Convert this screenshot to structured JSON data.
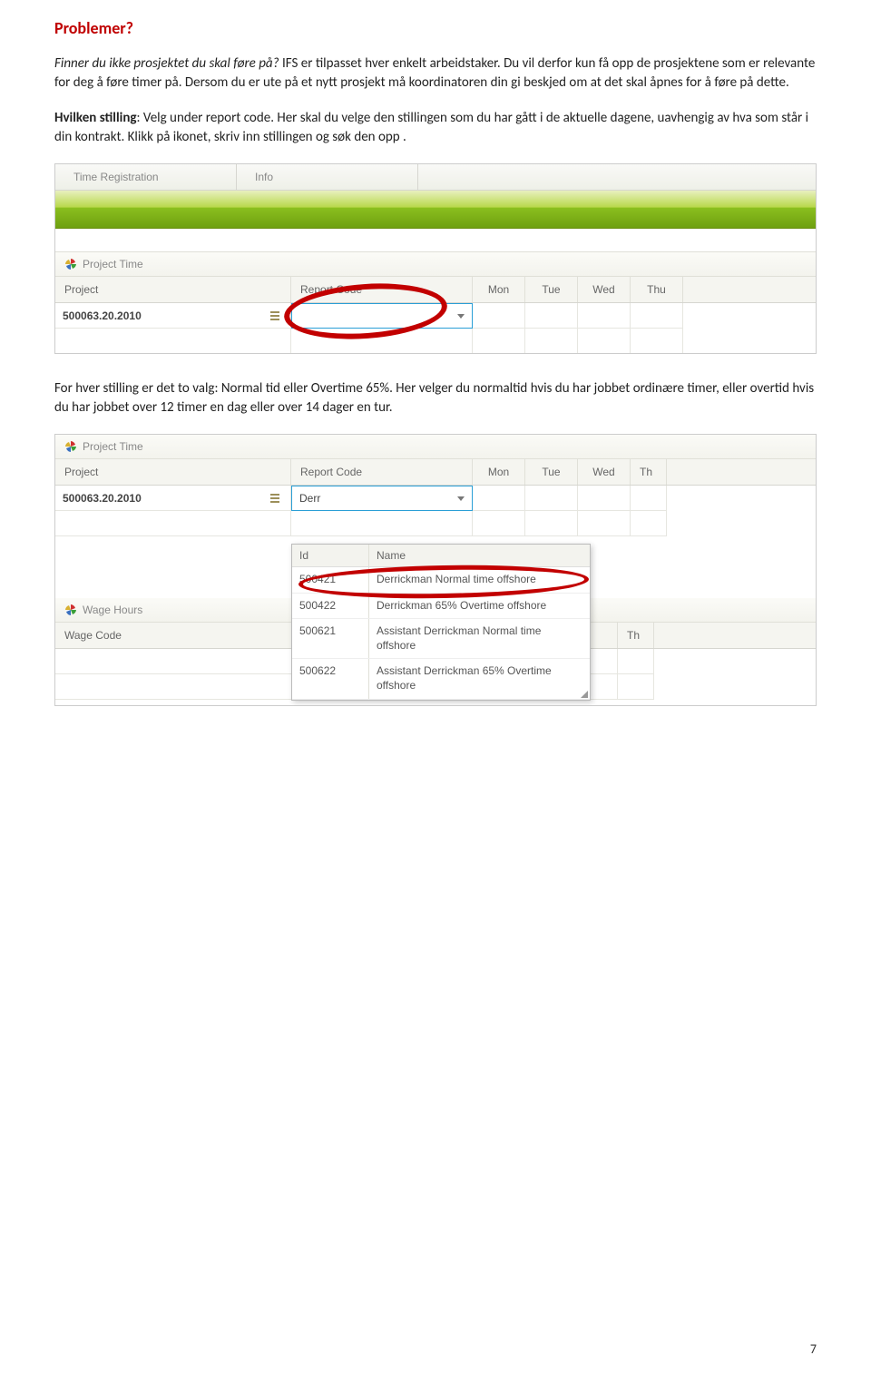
{
  "heading": "Problemer?",
  "para1_italic": "Finner du ikke prosjektet du skal føre på?",
  "para1_rest": " IFS er tilpasset hver enkelt arbeidstaker. Du vil derfor kun få opp de prosjektene som er relevante for deg å føre timer på. Dersom du er ute på et nytt prosjekt må koordinatoren din gi beskjed om at det skal åpnes for å føre på dette.",
  "para2_bold": "Hvilken stilling",
  "para2_rest": ": Velg under report code. Her skal du velge den stillingen som du har gått i de aktuelle dagene, uavhengig av hva som står i din kontrakt. Klikk på ikonet, skriv inn stillingen og søk den opp .",
  "screenshot1": {
    "tabs": [
      "Time Registration",
      "Info"
    ],
    "section": "Project Time",
    "cols": {
      "project": "Project",
      "report": "Report Code",
      "days": [
        "Mon",
        "Tue",
        "Wed",
        "Thu"
      ]
    },
    "project_value": "500063.20.2010"
  },
  "para3": "For hver stilling er det to valg: Normal tid eller Overtime 65%. Her velger du normaltid hvis du har jobbet ordinære timer, eller overtid hvis du har jobbet over 12 timer en dag eller over 14 dager en tur.",
  "screenshot2": {
    "section1": "Project Time",
    "cols": {
      "project": "Project",
      "report": "Report Code",
      "days": [
        "Mon",
        "Tue",
        "Wed",
        "Th"
      ]
    },
    "project_value": "500063.20.2010",
    "report_input": "Derr",
    "dropdown": {
      "head_id": "Id",
      "head_name": "Name",
      "rows": [
        {
          "id": "500421",
          "name": "Derrickman Normal time offshore"
        },
        {
          "id": "500422",
          "name": "Derrickman 65% Overtime offshore"
        },
        {
          "id": "500621",
          "name": "Assistant Derrickman Normal time offshore"
        },
        {
          "id": "500622",
          "name": "Assistant Derrickman 65% Overtime offshore"
        }
      ]
    },
    "section2": "Wage Hours",
    "wage_label": "Wage Code",
    "wage_day": "Th"
  },
  "page_number": "7"
}
